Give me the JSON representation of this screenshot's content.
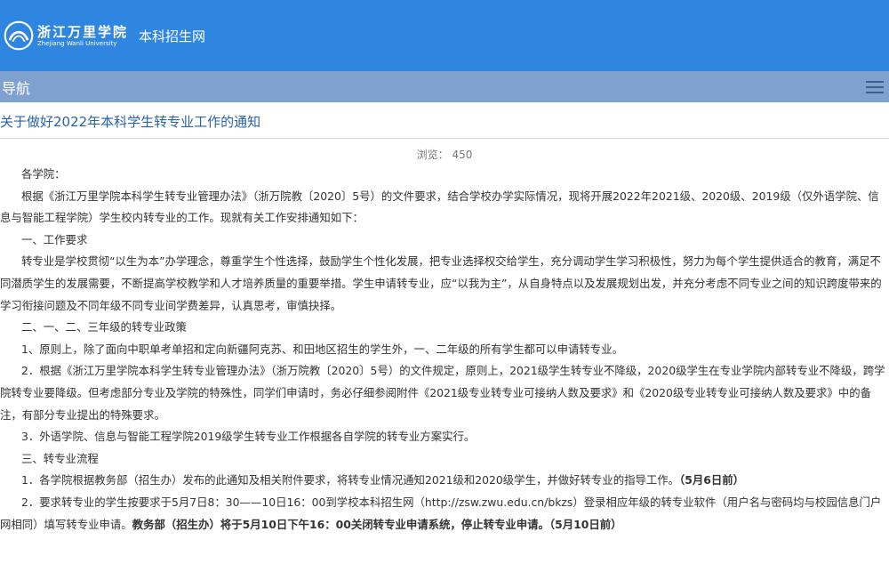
{
  "header": {
    "logo_cn": "浙江万里学院",
    "logo_en": "Zhejiang Wanli University",
    "site_name": "本科招生网"
  },
  "nav": {
    "label": "导航",
    "menu_icon": "hamburger-icon"
  },
  "article": {
    "title": "关于做好2022年本科学生转专业工作的通知",
    "views_label": "浏览：",
    "views_count": "450",
    "paragraphs": [
      {
        "text": "各学院："
      },
      {
        "text": "根据《浙江万里学院本科学生转专业管理办法》（浙万院教〔2020〕5号）的文件要求，结合学校办学实际情况，现将开展2022年2021级、2020级、2019级（仅外语学院、信息与智能工程学院）学生校内转专业的工作。现就有关工作安排通知如下："
      },
      {
        "text": "一、工作要求"
      },
      {
        "text": "转专业是学校贯彻“以生为本”办学理念，尊重学生个性选择，鼓励学生个性化发展，把专业选择权交给学生，充分调动学生学习积极性，努力为每个学生提供适合的教育，满足不同潜质学生的发展需要，不断提高学校教学和人才培养质量的重要举措。学生申请转专业，应“以我为主”，从自身特点以及发展规划出发，并充分考虑不同专业之间的知识跨度带来的学习衔接问题及不同年级不同专业间学费差异，认真思考，审慎抉择。"
      },
      {
        "text": "二、一、二、三年级的转专业政策"
      },
      {
        "text": "1、原则上，除了面向中职单考单招和定向新疆阿克苏、和田地区招生的学生外，一、二年级的所有学生都可以申请转专业。"
      },
      {
        "text": "2．根据《浙江万里学院本科学生转专业管理办法》（浙万院教〔2020〕5号）的文件规定，原则上，2021级学生转专业不降级，2020级学生在专业学院内部转专业不降级，跨学院转专业要降级。但考虑部分专业及学院的特殊性，同学们申请时，务必仔细参阅附件《2021级专业转专业可接纳人数及要求》和《2020级专业转专业可接纳人数及要求》中的备注，有部分专业提出的特殊要求。"
      },
      {
        "text": "3．外语学院、信息与智能工程学院2019级学生转专业工作根据各自学院的转专业方案实行。"
      },
      {
        "text": "三、转专业流程"
      },
      {
        "text": "1．各学院根据教务部（招生办）发布的此通知及相关附件要求，将转专业情况通知2021级和2020级学生，并做好转专业的指导工作。",
        "bold": "（5月6日前）"
      },
      {
        "text": "2．要求转专业的学生按要求于5月7日8：30——10日16：00到学校本科招生网（http://zsw.zwu.edu.cn/bkzs）登录相应年级的转专业软件（用户名与密码均与校园信息门户网相同）填写转专业申请。",
        "bold": "教务部（招生办）将于5月10日下午16：00关闭转专业申请系统，停止转专业申请。（5月10日前）"
      }
    ]
  },
  "colors": {
    "header": "#2f86e0",
    "navbar": "#7ea1cf",
    "title": "#2a63a7"
  }
}
